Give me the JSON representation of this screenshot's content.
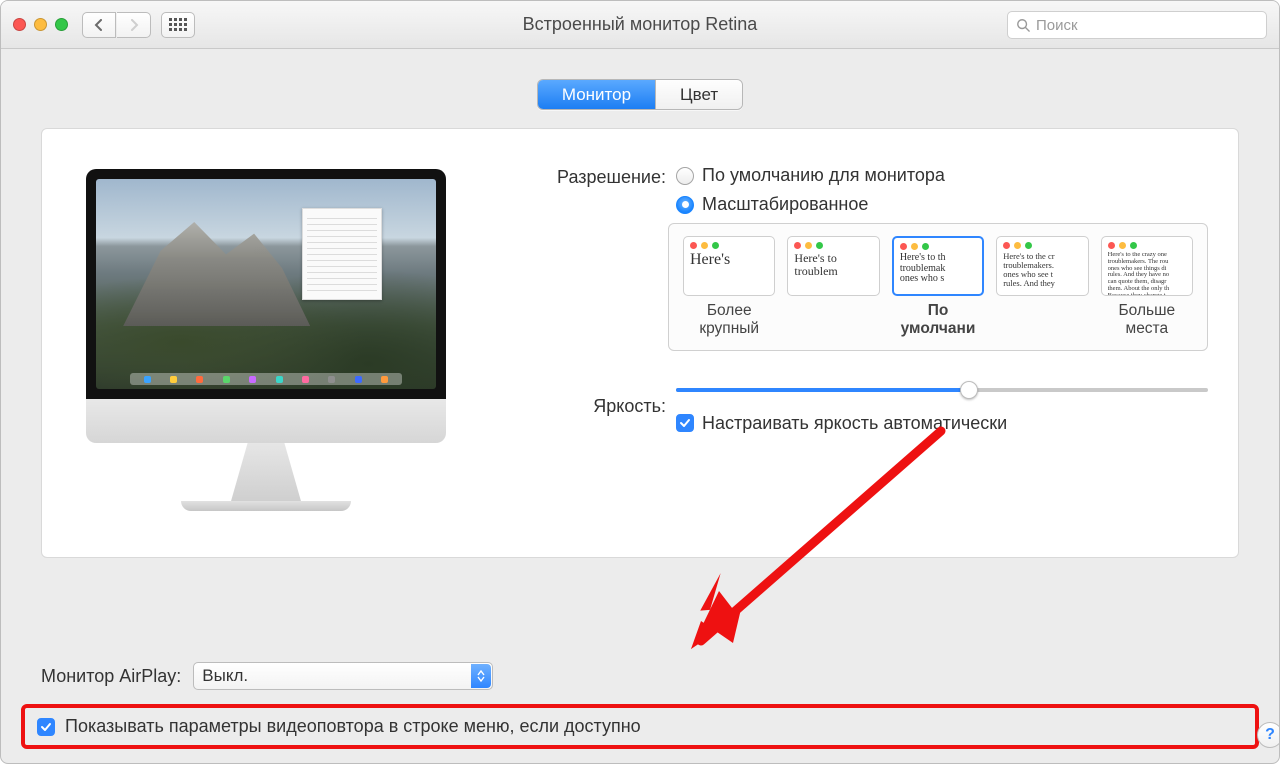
{
  "window": {
    "title": "Встроенный монитор Retina",
    "search_placeholder": "Поиск"
  },
  "tabs": {
    "display": "Монитор",
    "color": "Цвет"
  },
  "resolution": {
    "label": "Разрешение:",
    "option_default": "По умолчанию для монитора",
    "option_scaled": "Масштабированное",
    "scaled_selected": true,
    "scale_options": [
      {
        "label": "Более\nкрупный",
        "sample": "Here's",
        "selected": false
      },
      {
        "label": "",
        "sample": "Here's to\ntroublem",
        "selected": false
      },
      {
        "label": "По\nумолчани",
        "sample": "Here's to th\ntroublemak\nones who s",
        "selected": true
      },
      {
        "label": "",
        "sample": "Here's to the cr\ntroublemakers.\nones who see t\nrules. And they",
        "selected": false
      },
      {
        "label": "Больше\nместа",
        "sample": "Here's to the crazy one\ntroublemakers. The rou\nones who see things di\nrules. And they have no\ncan quote them, disagr\nthem. About the only th\nBecause they change t",
        "selected": false
      }
    ]
  },
  "brightness": {
    "label": "Яркость:",
    "value_percent": 55,
    "auto_label": "Настраивать яркость автоматически",
    "auto_checked": true
  },
  "airplay": {
    "label": "Монитор AirPlay:",
    "value": "Выкл."
  },
  "mirroring": {
    "label": "Показывать параметры видеоповтора в строке меню, если доступно",
    "checked": true
  },
  "help_label": "?",
  "dock_colors": [
    "#3aa3ff",
    "#ffcd3c",
    "#ff6a3c",
    "#5ad66a",
    "#c86aff",
    "#3ad6c8",
    "#ff6aa0",
    "#8e8e8e",
    "#3c6aff",
    "#ff9a3c"
  ]
}
